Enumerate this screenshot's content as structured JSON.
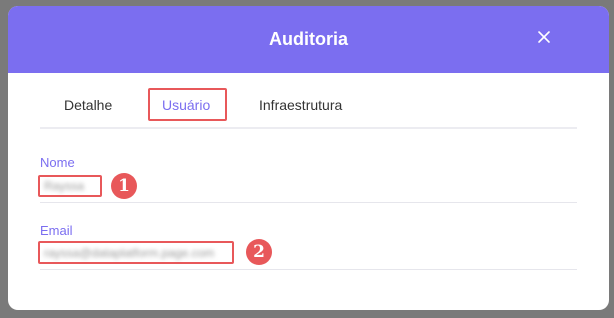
{
  "modal": {
    "title": "Auditoria",
    "close_icon": "close-icon"
  },
  "tabs": [
    {
      "label": "Detalhe",
      "active": false
    },
    {
      "label": "Usuário",
      "active": true
    },
    {
      "label": "Infraestrutura",
      "active": false
    }
  ],
  "fields": {
    "name": {
      "label": "Nome",
      "value": "Rayssa"
    },
    "email": {
      "label": "Email",
      "value": "rayssa@dataplatform.page.com"
    }
  },
  "annotations": [
    {
      "number": "1"
    },
    {
      "number": "2"
    }
  ],
  "colors": {
    "header": "#7b6ef0",
    "accent": "#7b6ef0",
    "annotation": "#e8585a"
  }
}
